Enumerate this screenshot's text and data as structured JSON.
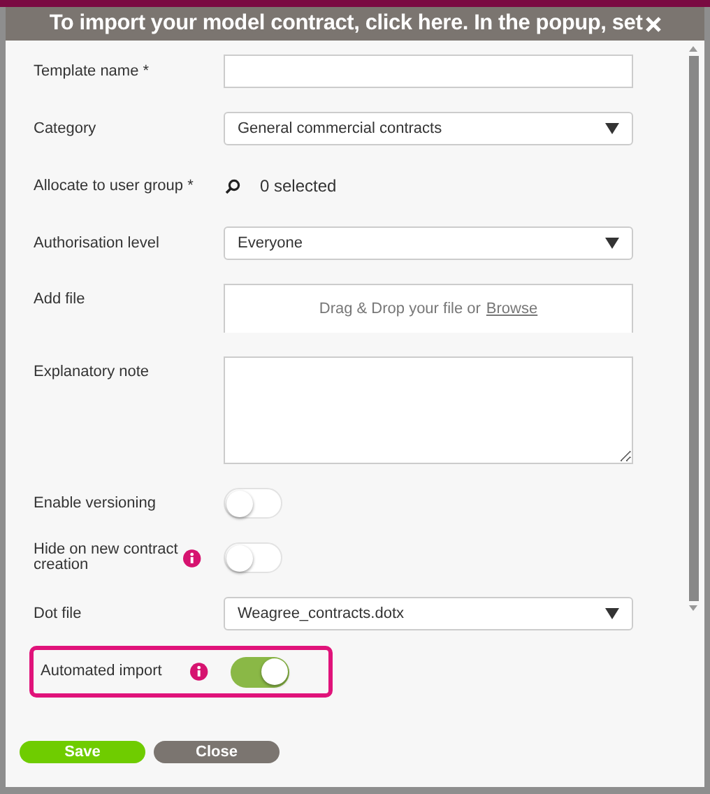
{
  "dialog": {
    "title": "To import your model contract, click here. In the popup, set",
    "fields": [
      {
        "kind": "text",
        "label": "Template name *"
      },
      {
        "kind": "select",
        "label": "Category",
        "value": "General commercial contracts"
      },
      {
        "kind": "search",
        "label": "Allocate to user group *",
        "value": "0 selected"
      },
      {
        "kind": "select",
        "label": "Authorisation level",
        "value": "Everyone"
      },
      {
        "kind": "file",
        "label": "Add file",
        "hint": "Drag & Drop your file or",
        "link": "Browse"
      },
      {
        "kind": "textarea",
        "label": "Explanatory note"
      },
      {
        "kind": "toggle",
        "label": "Enable versioning",
        "on": false,
        "info": false,
        "highlighted": false
      },
      {
        "kind": "toggle",
        "label": "Hide on new contract creation",
        "on": false,
        "info": true,
        "highlighted": false
      },
      {
        "kind": "select",
        "label": "Dot file",
        "value": "Weagree_contracts.dotx"
      },
      {
        "kind": "toggle",
        "label": "Automated import",
        "on": true,
        "info": true,
        "highlighted": true
      }
    ],
    "buttons": [
      {
        "label": "Save",
        "kind": "primary"
      },
      {
        "label": "Close",
        "kind": "secondary"
      }
    ]
  }
}
